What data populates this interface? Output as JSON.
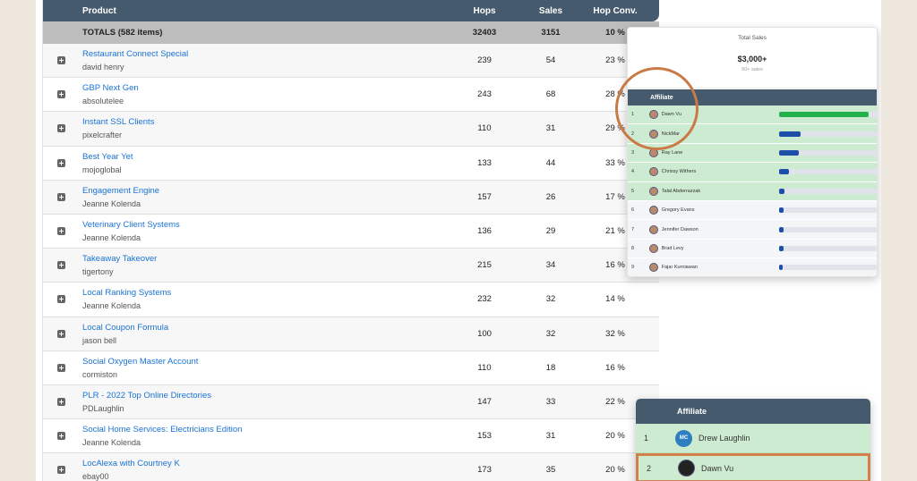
{
  "table": {
    "headers": {
      "product": "Product",
      "hops": "Hops",
      "sales": "Sales",
      "hop_conv": "Hop Conv."
    },
    "totals": {
      "label": "TOTALS (582 items)",
      "hops": "32403",
      "sales": "3151",
      "hop_conv": "10 %"
    },
    "rows": [
      {
        "name": "Restaurant Connect Special",
        "vendor": "david henry",
        "hops": "239",
        "sales": "54",
        "conv": "23 %"
      },
      {
        "name": "GBP Next Gen",
        "vendor": "absolutelee",
        "hops": "243",
        "sales": "68",
        "conv": "28 %"
      },
      {
        "name": "Instant SSL Clients",
        "vendor": "pixelcrafter",
        "hops": "110",
        "sales": "31",
        "conv": "29 %"
      },
      {
        "name": "Best Year Yet",
        "vendor": "mojoglobal",
        "hops": "133",
        "sales": "44",
        "conv": "33 %"
      },
      {
        "name": "Engagement Engine",
        "vendor": "Jeanne Kolenda",
        "hops": "157",
        "sales": "26",
        "conv": "17 %"
      },
      {
        "name": "Veterinary Client Systems",
        "vendor": "Jeanne Kolenda",
        "hops": "136",
        "sales": "29",
        "conv": "21 %"
      },
      {
        "name": "Takeaway Takeover",
        "vendor": "tigertony",
        "hops": "215",
        "sales": "34",
        "conv": "16 %"
      },
      {
        "name": "Local Ranking Systems",
        "vendor": "Jeanne Kolenda",
        "hops": "232",
        "sales": "32",
        "conv": "14 %"
      },
      {
        "name": "Local Coupon Formula",
        "vendor": "jason bell",
        "hops": "100",
        "sales": "32",
        "conv": "32 %"
      },
      {
        "name": "Social Oxygen Master Account",
        "vendor": "cormiston",
        "hops": "110",
        "sales": "18",
        "conv": "16 %"
      },
      {
        "name": "PLR - 2022 Top Online Directories",
        "vendor": "PDLaughlin",
        "hops": "147",
        "sales": "33",
        "conv": "22 %"
      },
      {
        "name": "Social Home Services: Electricians Edition",
        "vendor": "Jeanne Kolenda",
        "hops": "153",
        "sales": "31",
        "conv": "20 %"
      },
      {
        "name": "LocAlexa with Courtney K",
        "vendor": "ebay00",
        "hops": "173",
        "sales": "35",
        "conv": "20 %"
      }
    ]
  },
  "leaderboard": {
    "title": "Total Sales",
    "amount": "$3,000+",
    "subtitle": "50+ sales",
    "header": "Affiliate",
    "accent_green": "#22b14c",
    "accent_blue": "#1d4fa8",
    "rows": [
      {
        "rank": "1",
        "name": "Dawn Vu",
        "progress": 0.92,
        "color": "#22b14c",
        "bg": "g"
      },
      {
        "rank": "2",
        "name": "NickMar",
        "progress": 0.22,
        "color": "#1d4fa8",
        "bg": "g"
      },
      {
        "rank": "3",
        "name": "Ray Lane",
        "progress": 0.2,
        "color": "#1d4fa8",
        "bg": "g"
      },
      {
        "rank": "4",
        "name": "Chrissy Withers",
        "progress": 0.1,
        "color": "#1d4fa8",
        "bg": "g"
      },
      {
        "rank": "5",
        "name": "Talal Abderrazzak",
        "progress": 0.06,
        "color": "#1d4fa8",
        "bg": "g"
      },
      {
        "rank": "6",
        "name": "Gregory Evans",
        "progress": 0.05,
        "color": "#1d4fa8",
        "bg": "w"
      },
      {
        "rank": "7",
        "name": "Jennifer Dawson",
        "progress": 0.05,
        "color": "#1d4fa8",
        "bg": "w"
      },
      {
        "rank": "8",
        "name": "Brad Levy",
        "progress": 0.05,
        "color": "#1d4fa8",
        "bg": "w"
      },
      {
        "rank": "9",
        "name": "Fajar Kurniawan",
        "progress": 0.04,
        "color": "#1d4fa8",
        "bg": "w"
      }
    ]
  },
  "affiliate_zoom": {
    "header": "Affiliate",
    "rows": [
      {
        "rank": "1",
        "name": "Drew Laughlin",
        "avatar_text": "MC"
      },
      {
        "rank": "2",
        "name": "Dawn Vu",
        "avatar_text": ""
      }
    ]
  }
}
